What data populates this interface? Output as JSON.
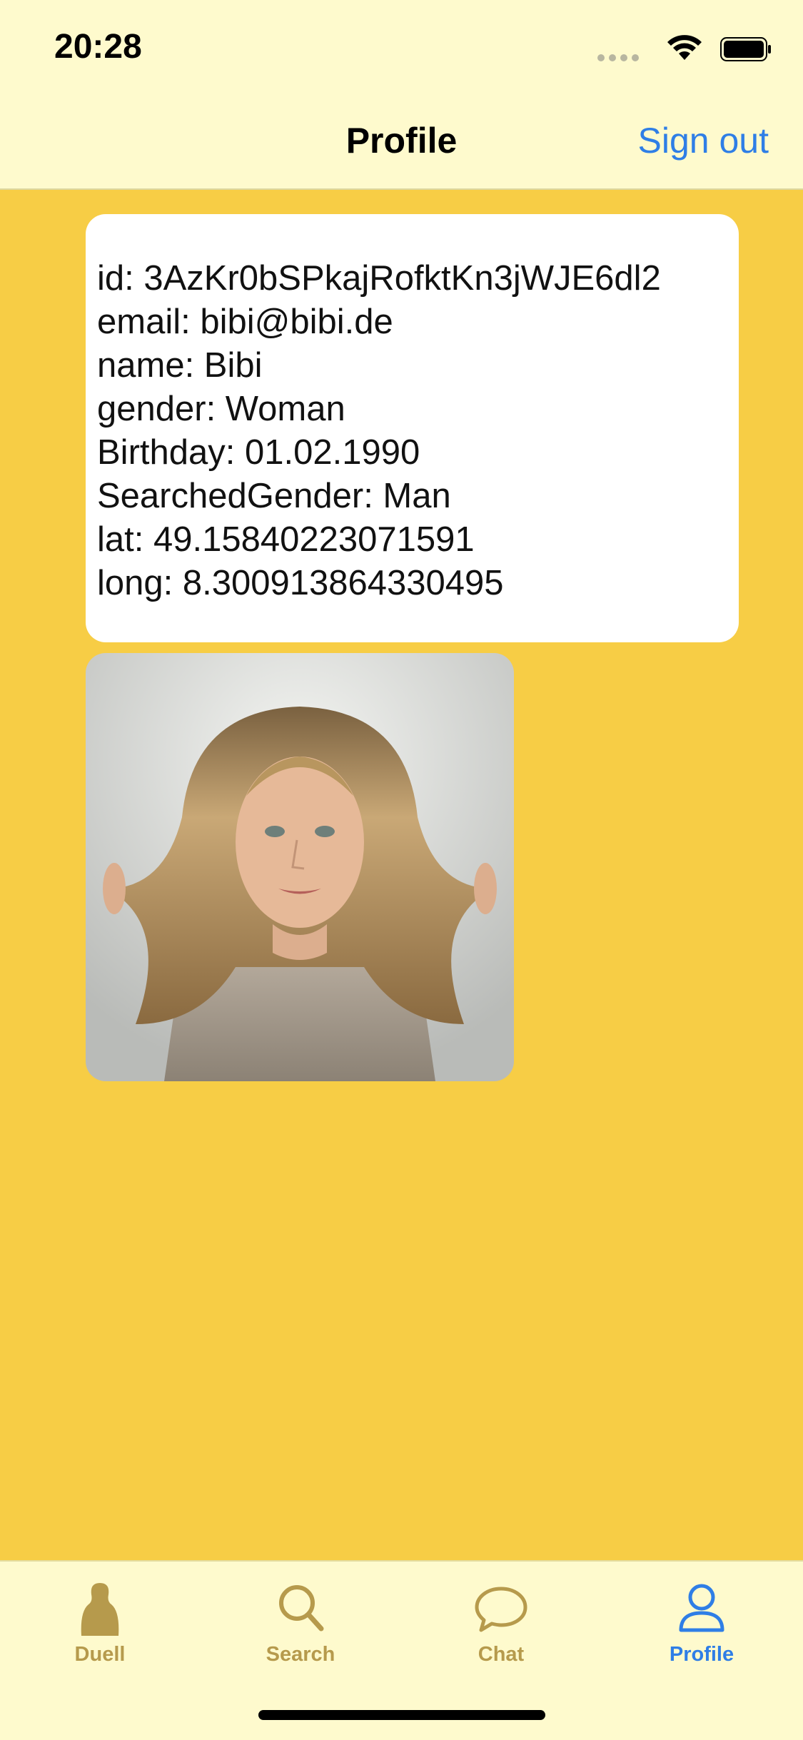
{
  "status_bar": {
    "time": "20:28"
  },
  "nav": {
    "title": "Profile",
    "sign_out_label": "Sign out"
  },
  "profile": {
    "lines": [
      "id: 3AzKr0bSPkajRofktKn3jWJE6dl2",
      "email: bibi@bibi.de",
      "name: Bibi",
      "gender: Woman",
      "Birthday: 01.02.1990",
      "SearchedGender: Man",
      "lat: 49.15840223071591",
      "long: 8.300913864330495"
    ]
  },
  "tabs": [
    {
      "label": "Duell",
      "icon": "person-silhouette-icon",
      "active": false
    },
    {
      "label": "Search",
      "icon": "search-icon",
      "active": false
    },
    {
      "label": "Chat",
      "icon": "chat-bubble-icon",
      "active": false
    },
    {
      "label": "Profile",
      "icon": "person-icon",
      "active": true
    }
  ],
  "colors": {
    "background": "#F7CD45",
    "bar_background": "#FEFACD",
    "accent": "#2F7EE6",
    "inactive_tab": "#B69A4C"
  }
}
